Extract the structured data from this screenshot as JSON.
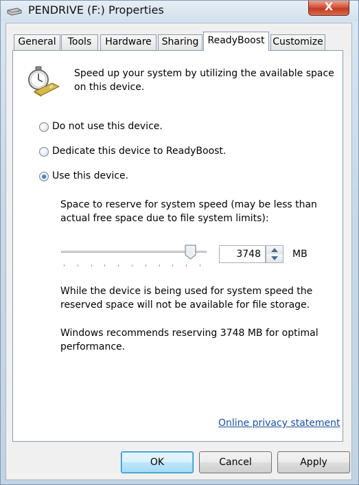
{
  "window": {
    "title": "PENDRIVE (F:) Properties",
    "close_glyph": "X",
    "title_icon": "drive-icon"
  },
  "tabs": [
    {
      "label": "General",
      "active": false
    },
    {
      "label": "Tools",
      "active": false
    },
    {
      "label": "Hardware",
      "active": false
    },
    {
      "label": "Sharing",
      "active": false
    },
    {
      "label": "ReadyBoost",
      "active": true
    },
    {
      "label": "Customize",
      "active": false
    }
  ],
  "readyboost": {
    "header_icon": "readyboost-stopwatch-icon",
    "intro_line1": "Speed up your system by utilizing the available space",
    "intro_line2": "on this device.",
    "options": [
      {
        "label": "Do not use this device.",
        "selected": false
      },
      {
        "label": "Dedicate this device to ReadyBoost.",
        "selected": false
      },
      {
        "label": "Use this device.",
        "selected": true
      }
    ],
    "reserve_line1": "Space to reserve for system speed (may be less than",
    "reserve_line2": "actual free space due to file system limits):",
    "slider_fraction": 0.93,
    "reserve_value": "3748",
    "unit": "MB",
    "warning_line1": "While the device is being used for system speed the",
    "warning_line2": "reserved space will not be available for file storage.",
    "recommend_line1": "Windows recommends reserving 3748 MB for optimal",
    "recommend_line2": "performance.",
    "privacy_link": "Online privacy statement"
  },
  "buttons": {
    "ok": "OK",
    "cancel": "Cancel",
    "apply": "Apply"
  },
  "colors": {
    "link": "#1a4fa0",
    "close_button": "#c13c22",
    "default_button_border": "#3c7fb1"
  }
}
